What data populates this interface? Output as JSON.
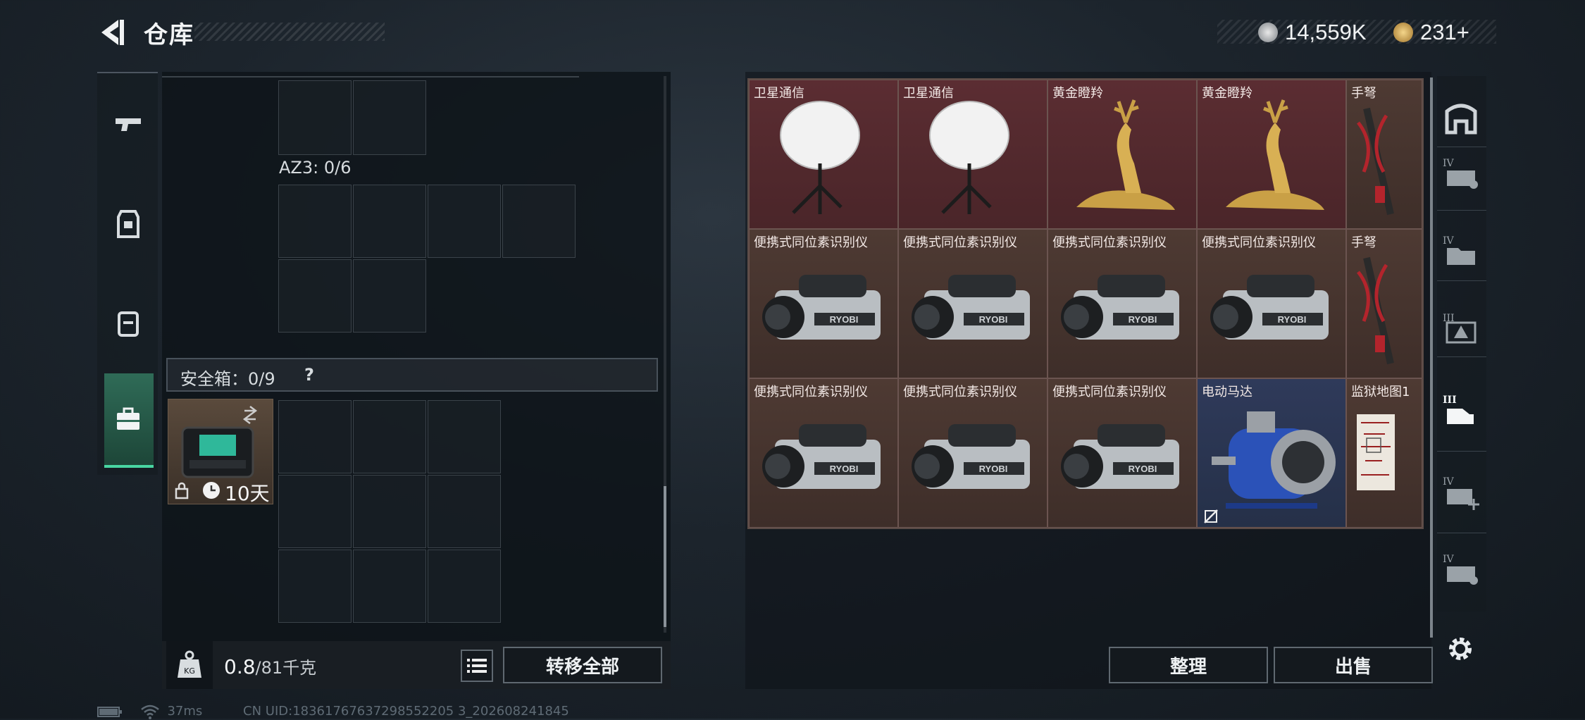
{
  "header": {
    "title": "仓库"
  },
  "currency": {
    "coins": "14,559K",
    "tokens": "231+"
  },
  "left_sidebar": {
    "tabs": [
      "weapon-icon",
      "armor-icon",
      "backpack-icon",
      "safebox-icon"
    ],
    "active": 3
  },
  "container": {
    "az3_label": "AZ3: 0/6",
    "safe_box_label": "安全箱：0/9",
    "help": "?",
    "safe_item_timer": "10天"
  },
  "weight": {
    "current": "0.8",
    "max": "/81千克"
  },
  "buttons": {
    "transfer_all": "转移全部",
    "sort": "整理",
    "sell": "出售"
  },
  "inventory": {
    "slots": [
      {
        "name": "卫星通信",
        "type": "dish",
        "bg": "red"
      },
      {
        "name": "卫星通信",
        "type": "dish",
        "bg": "red"
      },
      {
        "name": "黄金瞪羚",
        "type": "deer",
        "bg": "red"
      },
      {
        "name": "黄金瞪羚",
        "type": "deer",
        "bg": "red"
      },
      {
        "name": "手弩",
        "type": "crossbow",
        "bg": "brown"
      },
      {
        "name": "便携式同位素识别仪",
        "type": "camera",
        "bg": "brown"
      },
      {
        "name": "便携式同位素识别仪",
        "type": "camera",
        "bg": "brown"
      },
      {
        "name": "便携式同位素识别仪",
        "type": "camera",
        "bg": "brown"
      },
      {
        "name": "便携式同位素识别仪",
        "type": "camera",
        "bg": "brown"
      },
      {
        "name": "手弩",
        "type": "crossbow",
        "bg": "brown"
      },
      {
        "name": "便携式同位素识别仪",
        "type": "camera",
        "bg": "brown"
      },
      {
        "name": "便携式同位素识别仪",
        "type": "camera",
        "bg": "brown"
      },
      {
        "name": "便携式同位素识别仪",
        "type": "camera",
        "bg": "brown"
      },
      {
        "name": "电动马达",
        "type": "motor",
        "bg": "blue"
      },
      {
        "name": "监狱地图1",
        "type": "map",
        "bg": "brown"
      }
    ],
    "camera_brand": "RYOBI"
  },
  "right_sidebar": {
    "tabs": [
      "home-icon",
      "case-iv-icon",
      "folder-iv-icon",
      "hazard-iii-icon",
      "hand-iii-icon",
      "add-iv-icon",
      "case-iv-icon-2"
    ],
    "active": 4
  },
  "status": {
    "ping": "37ms",
    "uid": "CN UID:18361767637298552205 3_202608241845"
  },
  "colors": {
    "accent": "#48d6a2",
    "red_slot": "#5b2d32",
    "brown_slot": "#4e3a33",
    "blue_slot": "#2f3a5a"
  }
}
